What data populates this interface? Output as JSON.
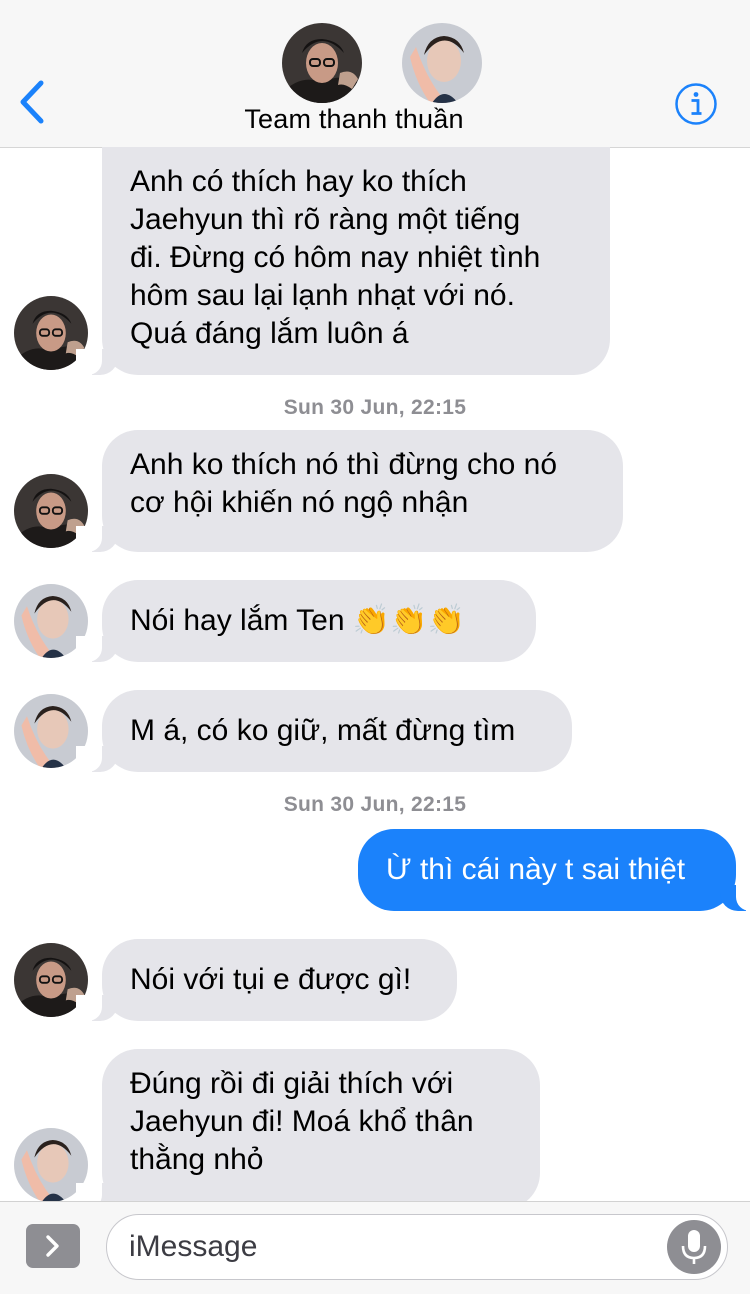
{
  "header": {
    "title": "Team thanh thuần",
    "icons": {
      "back": "chevron-left-icon",
      "info": "info-icon"
    },
    "accent_color": "#1b82fb"
  },
  "messages": [
    {
      "type": "received",
      "sender": "ten",
      "text": "Anh có thích hay ko thích\nJaehyun thì rõ ràng một tiếng\nđi. Đừng có hôm nay nhiệt tình\nhôm sau lại lạnh nhạt với nó.\nQuá đáng lắm luôn á"
    },
    {
      "type": "timestamp",
      "text": "Sun 30 Jun, 22:15"
    },
    {
      "type": "received",
      "sender": "ten",
      "text": "Anh ko thích nó thì đừng cho nó\ncơ hội khiến nó ngộ nhận"
    },
    {
      "type": "received",
      "sender": "friend",
      "text": "Nói hay lắm Ten 👏👏👏"
    },
    {
      "type": "received",
      "sender": "friend",
      "text": "M á, có ko giữ, mất đừng tìm"
    },
    {
      "type": "timestamp",
      "text": "Sun 30 Jun, 22:15"
    },
    {
      "type": "sent",
      "text": "Ừ thì cái này t sai thiệt"
    },
    {
      "type": "received",
      "sender": "ten",
      "text": "Nói với tụi e được gì!"
    },
    {
      "type": "received",
      "sender": "friend",
      "text": "Đúng rồi đi giải thích với\nJaehyun đi! Moá khổ thân\nthằng nhỏ"
    }
  ],
  "input": {
    "placeholder": "iMessage",
    "value": "",
    "icons": {
      "expand": "chevron-right-icon",
      "mic": "microphone-icon"
    }
  },
  "colors": {
    "received_bubble": "#e5e5ea",
    "sent_bubble": "#1b82fb",
    "timestamp": "#8e8e93"
  }
}
